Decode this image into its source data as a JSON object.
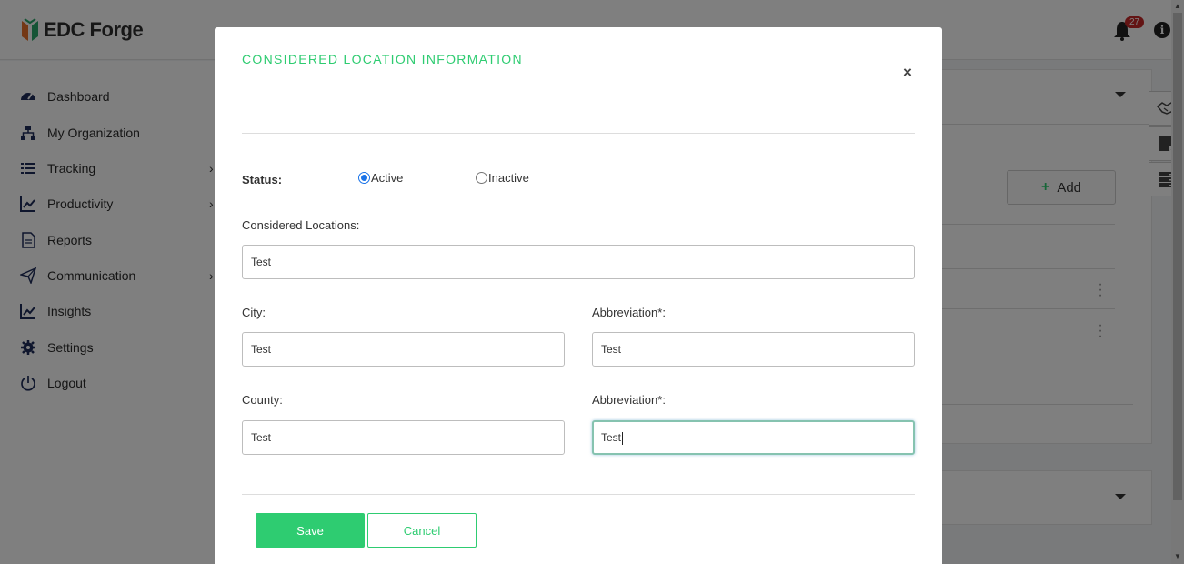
{
  "app": {
    "logo_text": "EDC Forge",
    "notification_count": "27"
  },
  "sidebar": {
    "items": [
      {
        "label": "Dashboard",
        "icon": "dashboard-icon",
        "has_submenu": false
      },
      {
        "label": "My Organization",
        "icon": "org-chart-icon",
        "has_submenu": false
      },
      {
        "label": "Tracking",
        "icon": "list-icon",
        "has_submenu": true
      },
      {
        "label": "Productivity",
        "icon": "line-chart-icon",
        "has_submenu": true
      },
      {
        "label": "Reports",
        "icon": "document-icon",
        "has_submenu": false
      },
      {
        "label": "Communication",
        "icon": "paper-plane-icon",
        "has_submenu": true
      },
      {
        "label": "Insights",
        "icon": "line-chart-icon",
        "has_submenu": false
      },
      {
        "label": "Settings",
        "icon": "gear-icon",
        "has_submenu": false
      },
      {
        "label": "Logout",
        "icon": "power-icon",
        "has_submenu": false
      }
    ]
  },
  "content": {
    "add_label": "Add"
  },
  "modal": {
    "title": "CONSIDERED LOCATION INFORMATION",
    "close_symbol": "×",
    "status_label": "Status:",
    "status_options": [
      {
        "label": "Active",
        "selected": true
      },
      {
        "label": "Inactive",
        "selected": false
      }
    ],
    "considered_locations": {
      "label": "Considered Locations:",
      "value": "Test"
    },
    "city": {
      "label": "City:",
      "value": "Test"
    },
    "city_abbreviation": {
      "label": "Abbreviation*:",
      "value": "Test"
    },
    "county": {
      "label": "County:",
      "value": "Test"
    },
    "county_abbreviation": {
      "label": "Abbreviation*:",
      "value": "Test"
    },
    "save_label": "Save",
    "cancel_label": "Cancel"
  },
  "colors": {
    "accent": "#2ecc71",
    "badge": "#c62828",
    "radio": "#1a73e8"
  }
}
